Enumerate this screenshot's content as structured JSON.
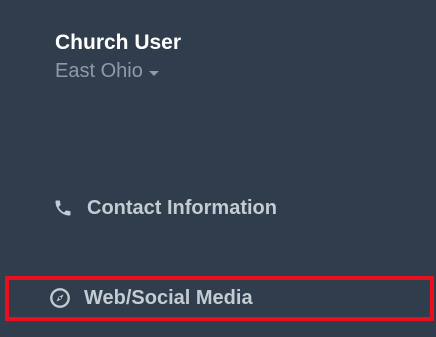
{
  "user": {
    "name": "Church User",
    "region": "East Ohio"
  },
  "nav": {
    "contact": {
      "label": "Contact Information",
      "icon": "phone-icon"
    },
    "web": {
      "label": "Web/Social Media",
      "icon": "compass-icon"
    }
  },
  "colors": {
    "background": "#2f3d4c",
    "highlight": "#e8101f",
    "muted": "#8d9aa9"
  }
}
